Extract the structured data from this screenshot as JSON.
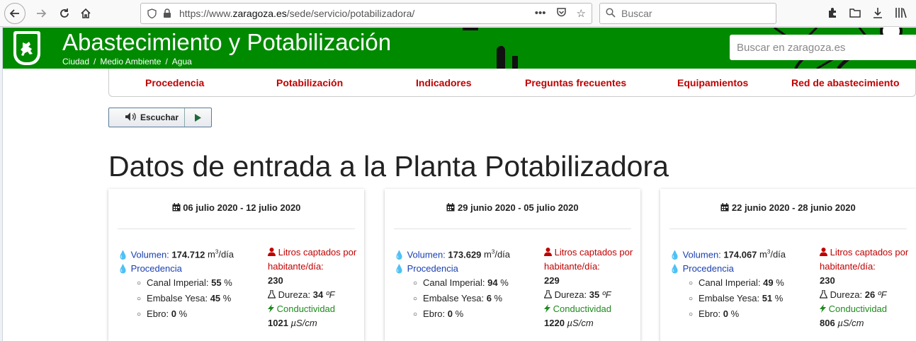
{
  "browser": {
    "url_prefix": "https://www.",
    "url_domain": "zaragoza.es",
    "url_path": "/sede/servicio/potabilizadora/",
    "search_placeholder": "Buscar"
  },
  "header": {
    "title": "Abastecimiento y Potabilización",
    "breadcrumb": [
      "Ciudad",
      "Medio Ambiente",
      "Agua"
    ],
    "search_placeholder": "Buscar en zaragoza.es",
    "brand_color": "#008a00"
  },
  "menu": [
    "Procedencia",
    "Potabilización",
    "Indicadores",
    "Preguntas frecuentes",
    "Equipamientos",
    "Red de abastecimiento"
  ],
  "listen": {
    "label": "Escuchar"
  },
  "page_title": "Datos de entrada a la Planta Potabilizadora",
  "cards": [
    {
      "date": "06 julio 2020 - 12 julio 2020",
      "volumen_label": "Volumen:",
      "volumen_value": "174.712",
      "volumen_unit": "m",
      "volumen_unit_sup": "3",
      "volumen_unit_tail": "/día",
      "procedencia_label": "Procedencia",
      "canal_label": "Canal Imperial:",
      "canal_value": "55",
      "yesa_label": "Embalse Yesa:",
      "yesa_value": "45",
      "ebro_label": "Ebro:",
      "ebro_value": "0",
      "pct": "%",
      "litros_label": "Litros captados por habitante/día:",
      "litros_value": "230",
      "dureza_label": "Dureza:",
      "dureza_value": "34",
      "dureza_unit": "ºF",
      "conduct_label": "Conductividad",
      "conduct_value": "1021",
      "conduct_unit": "µS/cm"
    },
    {
      "date": "29 junio 2020 - 05 julio 2020",
      "volumen_label": "Volumen:",
      "volumen_value": "173.629",
      "volumen_unit": "m",
      "volumen_unit_sup": "3",
      "volumen_unit_tail": "/día",
      "procedencia_label": "Procedencia",
      "canal_label": "Canal Imperial:",
      "canal_value": "94",
      "yesa_label": "Embalse Yesa:",
      "yesa_value": "6",
      "ebro_label": "Ebro:",
      "ebro_value": "0",
      "pct": "%",
      "litros_label": "Litros captados por habitante/día:",
      "litros_value": "229",
      "dureza_label": "Dureza:",
      "dureza_value": "35",
      "dureza_unit": "ºF",
      "conduct_label": "Conductividad",
      "conduct_value": "1220",
      "conduct_unit": "µS/cm"
    },
    {
      "date": "22 junio 2020 - 28 junio 2020",
      "volumen_label": "Volumen:",
      "volumen_value": "174.067",
      "volumen_unit": "m",
      "volumen_unit_sup": "3",
      "volumen_unit_tail": "/día",
      "procedencia_label": "Procedencia",
      "canal_label": "Canal Imperial:",
      "canal_value": "49",
      "yesa_label": "Embalse Yesa:",
      "yesa_value": "51",
      "ebro_label": "Ebro:",
      "ebro_value": "0",
      "pct": "%",
      "litros_label": "Litros captados por habitante/día:",
      "litros_value": "230",
      "dureza_label": "Dureza:",
      "dureza_value": "26",
      "dureza_unit": "ºF",
      "conduct_label": "Conductividad",
      "conduct_value": "806",
      "conduct_unit": "µS/cm"
    }
  ]
}
